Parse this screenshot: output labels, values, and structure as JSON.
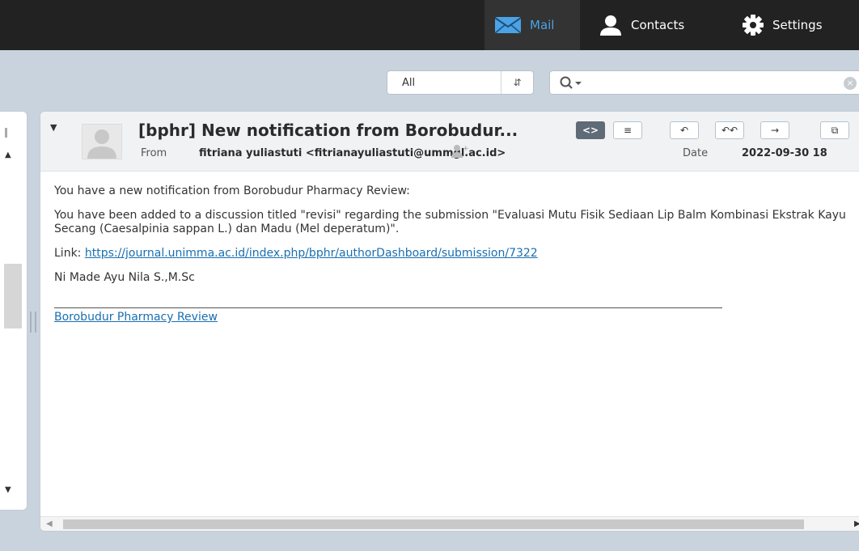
{
  "nav": {
    "mail_label": "Mail",
    "contacts_label": "Contacts",
    "settings_label": "Settings"
  },
  "filter": {
    "selected": "All",
    "search_placeholder": ""
  },
  "message": {
    "subject": "[bphr] New notification from Borobudur...",
    "from_label": "From",
    "from_value": "fitriana yuliastuti <fitrianayuliastuti@ummgl.ac.id>",
    "date_label": "Date",
    "date_value": "2022-09-30 18",
    "body": {
      "line1": "You have a new notification from Borobudur Pharmacy Review:",
      "line2": "You have been added to a discussion titled \"revisi\" regarding the submission \"Evaluasi Mutu Fisik Sediaan Lip Balm Kombinasi Ekstrak Kayu Secang (Caesalpinia sappan L.) dan Madu (Mel deperatum)\".",
      "link_label": "Link:",
      "link_url": "https://journal.unimma.ac.id/index.php/bphr/authorDashboard/submission/7322",
      "sender_name": "Ni Made Ayu Nila S.,M.Sc",
      "signature_link": "Borobudur Pharmacy Review"
    }
  },
  "colors": {
    "topbar": "#222222",
    "accent": "#4aa3e6",
    "link": "#1a6fb0",
    "background": "#c9d3dd"
  },
  "icons": {
    "mail": "envelope-icon",
    "contacts": "person-icon",
    "settings": "gear-icon",
    "search": "magnifier-icon"
  }
}
